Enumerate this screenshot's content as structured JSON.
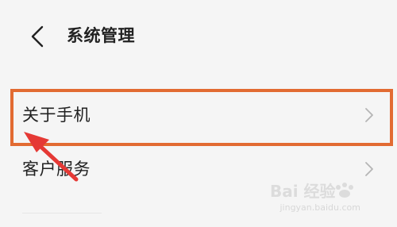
{
  "header": {
    "title": "系统管理"
  },
  "list": {
    "items": [
      {
        "label": "关于手机"
      },
      {
        "label": "客户服务"
      }
    ]
  },
  "watermark": {
    "logo_text": "Bai 经验",
    "url": "jingyan.baidu.com"
  },
  "colors": {
    "background": "#f5f5f5",
    "highlight_box": "#e26b32",
    "arrow": "#e53935"
  },
  "icons": {
    "back": "back-arrow-icon",
    "chevron": "chevron-right-icon"
  }
}
